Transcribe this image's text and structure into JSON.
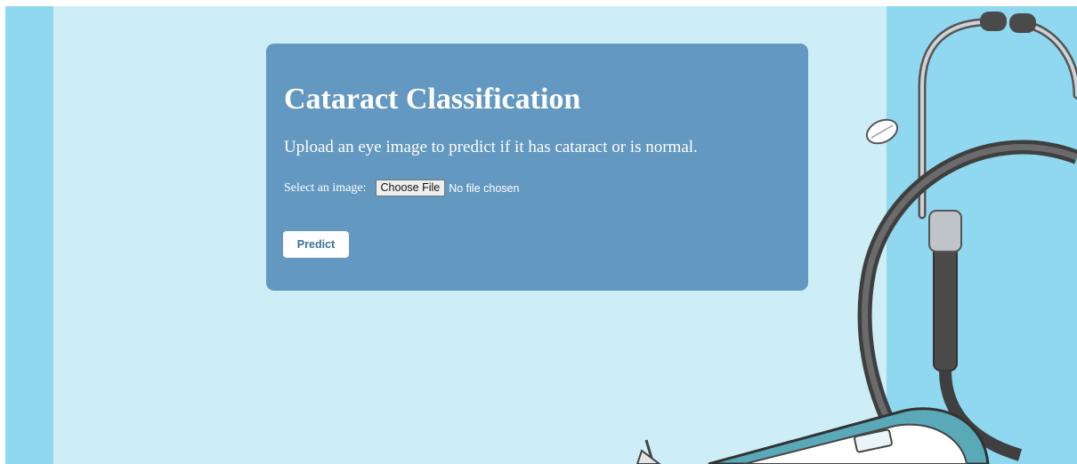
{
  "card": {
    "title": "Cataract Classification",
    "subtitle": "Upload an eye image to predict if it has cataract or is normal.",
    "file_label": "Select an image:",
    "choose_file_label": "Choose File",
    "file_status": "No file chosen",
    "predict_label": "Predict"
  },
  "colors": {
    "page_background": "#cdeef7",
    "side_strips": "#8fd8ef",
    "card_background": "#6398c1",
    "button_text": "#3d6f9a"
  },
  "illustration": {
    "icons": [
      "stethoscope-icon",
      "pill-icon",
      "clipboard-icon",
      "pen-icon"
    ]
  }
}
